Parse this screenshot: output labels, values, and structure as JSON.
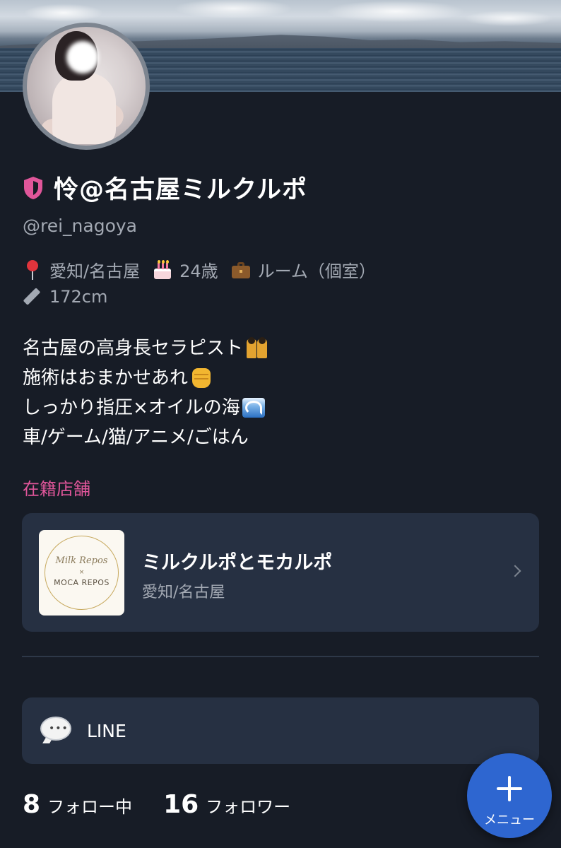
{
  "profile": {
    "display_name": "怜@名古屋ミルクルポ",
    "handle": "@rei_nagoya",
    "location": "愛知/名古屋",
    "age": "24歳",
    "room": "ルーム（個室）",
    "height": "172cm"
  },
  "bio": {
    "lines": [
      "名古屋の高身長セラピスト",
      "施術はおまかせあれ",
      "しっかり指圧×オイルの海",
      "車/ゲーム/猫/アニメ/ごはん"
    ]
  },
  "affiliation": {
    "section_label": "在籍店舗",
    "store_name": "ミルクルポとモカルポ",
    "store_location": "愛知/名古屋",
    "logo_text_top": "Milk Repos",
    "logo_text_x": "×",
    "logo_text_bottom": "MOCA REPOS"
  },
  "contact": {
    "line_label": "LINE"
  },
  "stats": {
    "following_count": "8",
    "following_label": "フォロー中",
    "followers_count": "16",
    "followers_label": "フォロワー"
  },
  "fab": {
    "menu_label": "メニュー"
  },
  "icons": {
    "verified": "shield-icon",
    "location": "pin-icon",
    "age": "cake-icon",
    "room": "briefcase-icon",
    "height": "ruler-icon",
    "line": "speech-bubble-icon",
    "menu": "plus-icon"
  },
  "colors": {
    "background": "#171c26",
    "card": "#263042",
    "accent_pink": "#e0569a",
    "muted_text": "#a3a9b3",
    "fab_blue": "#2e66d0"
  }
}
